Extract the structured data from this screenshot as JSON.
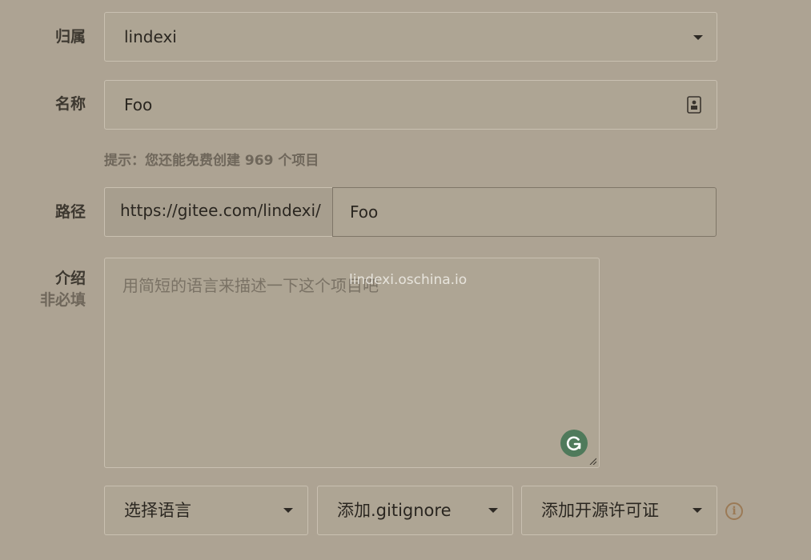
{
  "owner": {
    "label": "归属",
    "value": "lindexi"
  },
  "name": {
    "label": "名称",
    "value": "Foo"
  },
  "hint": "提示：您还能免费创建 969 个项目",
  "path": {
    "label": "路径",
    "prefix": "https://gitee.com/lindexi/",
    "value": "Foo"
  },
  "intro": {
    "label": "介绍",
    "sublabel": "非必填",
    "placeholder": "用简短的语言来描述一下这个项目吧"
  },
  "watermark": "lindexi.oschina.io",
  "selects": {
    "language": "选择语言",
    "gitignore": "添加.gitignore",
    "license": "添加开源许可证"
  },
  "icons": {
    "owner_dropdown": "chevron-down-icon",
    "name_field": "contact-card-icon",
    "grammarly": "grammarly-icon",
    "info": "info-icon"
  },
  "colors": {
    "background": "#ada393",
    "grammarly": "#4f7a5b",
    "info": "#9b7a56"
  }
}
